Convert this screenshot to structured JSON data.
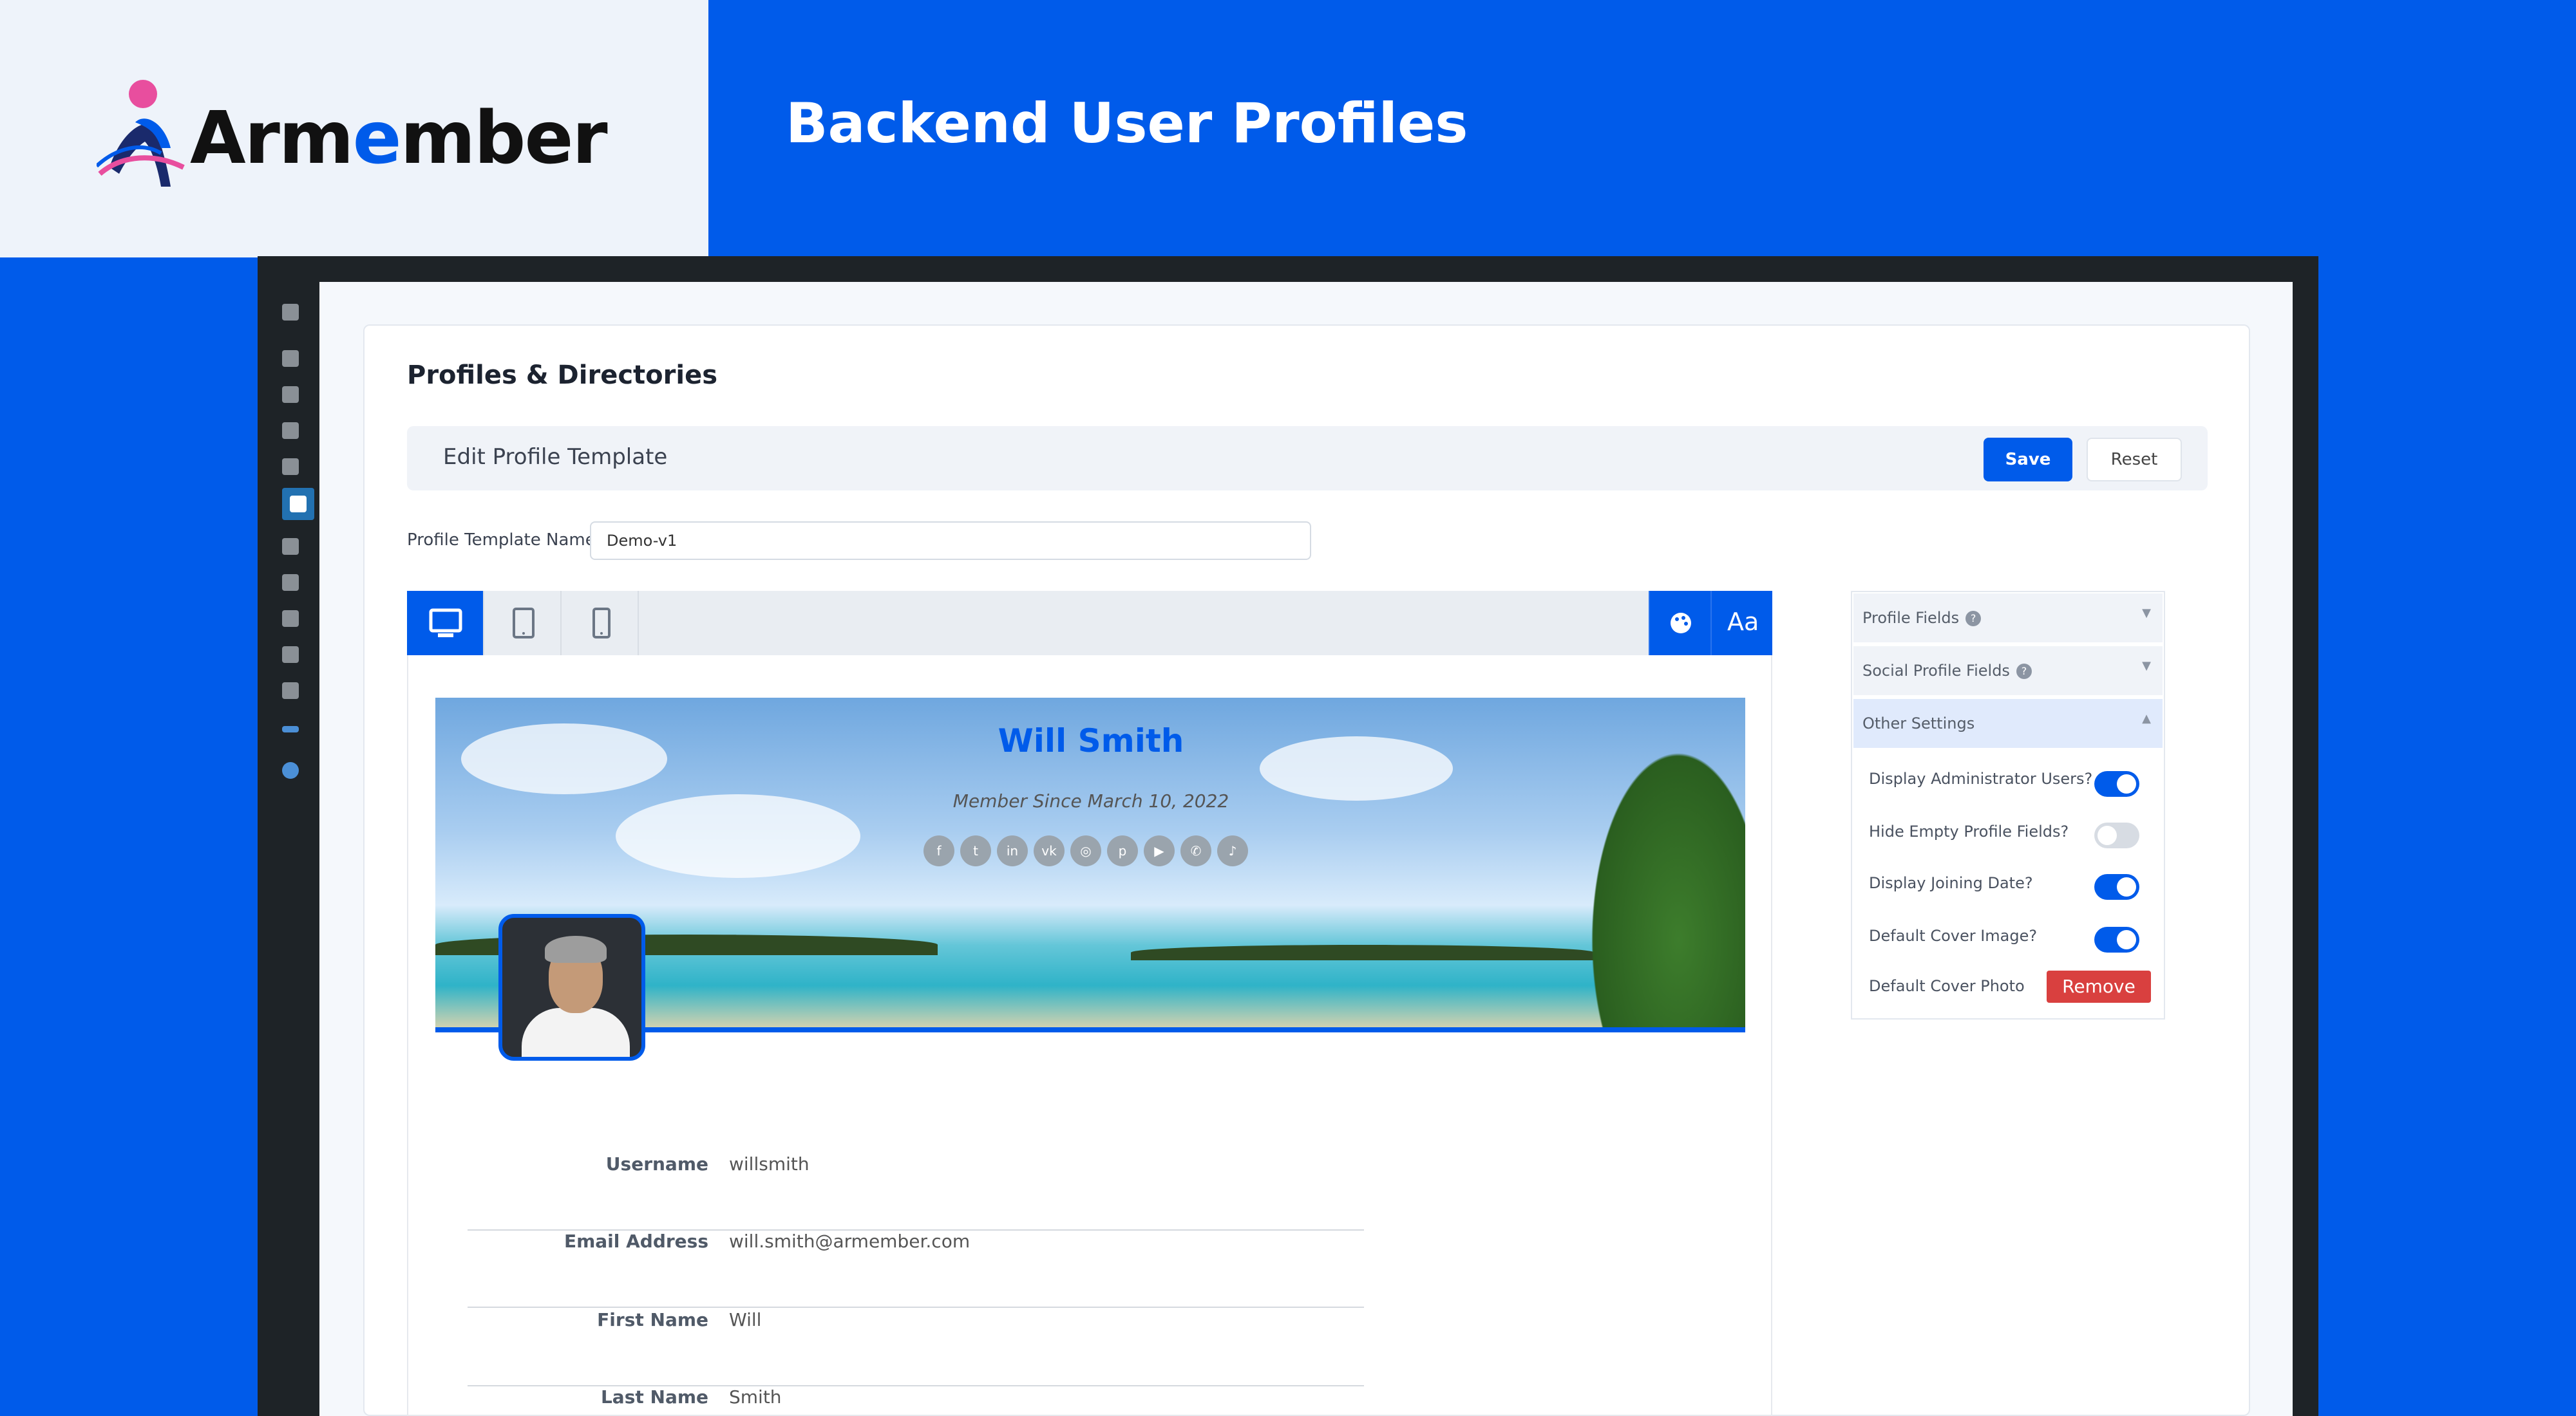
{
  "banner": {
    "brand_name": "Armember",
    "brand_prefix": "Arm",
    "brand_o": "e",
    "brand_suffix": "mber",
    "title": "Backend User Profiles"
  },
  "colors": {
    "accent": "#005bea",
    "danger": "#d9403f",
    "wp_sidebar": "#1e2327"
  },
  "page": {
    "title": "Profiles & Directories"
  },
  "editbar": {
    "title": "Edit Profile Template",
    "save_label": "Save",
    "reset_label": "Reset"
  },
  "template": {
    "name_label": "Profile Template Name",
    "name_value": "Demo-v1"
  },
  "toolbar": {
    "devices": [
      "desktop-icon",
      "tablet-icon",
      "mobile-icon"
    ],
    "right": [
      {
        "icon": "palette-icon"
      },
      {
        "icon": "font-icon",
        "text": "Aa"
      }
    ]
  },
  "profile": {
    "name": "Will Smith",
    "member_since": "Member Since March 10, 2022",
    "socials": [
      {
        "icon": "facebook-icon",
        "glyph": "f"
      },
      {
        "icon": "twitter-icon",
        "glyph": "t"
      },
      {
        "icon": "linkedin-icon",
        "glyph": "in"
      },
      {
        "icon": "vk-icon",
        "glyph": "vk"
      },
      {
        "icon": "instagram-icon",
        "glyph": "◎"
      },
      {
        "icon": "pinterest-icon",
        "glyph": "p"
      },
      {
        "icon": "youtube-icon",
        "glyph": "▶"
      },
      {
        "icon": "whatsapp-icon",
        "glyph": "✆"
      },
      {
        "icon": "tiktok-icon",
        "glyph": "♪"
      }
    ],
    "fields": [
      {
        "label": "Username",
        "value": "willsmith"
      },
      {
        "label": "Email Address",
        "value": "will.smith@armember.com"
      },
      {
        "label": "First Name",
        "value": "Will"
      },
      {
        "label": "Last Name",
        "value": "Smith"
      }
    ]
  },
  "sidebar": {
    "sections": [
      {
        "label": "Profile Fields",
        "help": "?",
        "caret": "▼"
      },
      {
        "label": "Social Profile Fields",
        "help": "?",
        "caret": "▼"
      },
      {
        "label": "Other Settings",
        "caret": "▲"
      }
    ],
    "options": [
      {
        "label": "Display Administrator Users?",
        "on": true
      },
      {
        "label": "Hide Empty Profile Fields?",
        "on": false
      },
      {
        "label": "Display Joining Date?",
        "on": true
      },
      {
        "label": "Default Cover Image?",
        "on": true
      }
    ],
    "cover_photo_label": "Default Cover Photo",
    "remove_label": "Remove"
  }
}
